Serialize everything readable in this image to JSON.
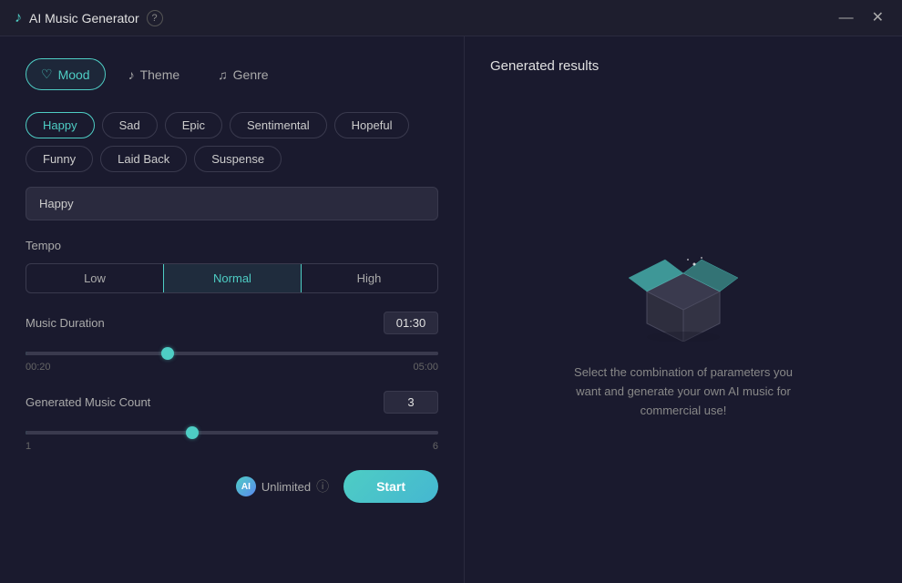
{
  "titleBar": {
    "title": "AI Music Generator",
    "helpLabel": "?",
    "minimizeLabel": "—",
    "closeLabel": "✕"
  },
  "tabs": [
    {
      "id": "mood",
      "label": "Mood",
      "icon": "♡",
      "active": true
    },
    {
      "id": "theme",
      "label": "Theme",
      "icon": "♪",
      "active": false
    },
    {
      "id": "genre",
      "label": "Genre",
      "icon": "♫",
      "active": false
    }
  ],
  "moodOptions": [
    {
      "label": "Happy",
      "selected": true
    },
    {
      "label": "Sad",
      "selected": false
    },
    {
      "label": "Epic",
      "selected": false
    },
    {
      "label": "Sentimental",
      "selected": false
    },
    {
      "label": "Hopeful",
      "selected": false
    },
    {
      "label": "Funny",
      "selected": false
    },
    {
      "label": "Laid Back",
      "selected": false
    },
    {
      "label": "Suspense",
      "selected": false
    }
  ],
  "selectedMood": "Happy",
  "tempo": {
    "label": "Tempo",
    "options": [
      {
        "label": "Low",
        "selected": false
      },
      {
        "label": "Normal",
        "selected": true
      },
      {
        "label": "High",
        "selected": false
      }
    ]
  },
  "musicDuration": {
    "label": "Music Duration",
    "min": "00:20",
    "max": "05:00",
    "value": "01:30",
    "fillPercent": 34
  },
  "generatedCount": {
    "label": "Generated Music Count",
    "min": "1",
    "max": "6",
    "value": "3",
    "fillPercent": 40
  },
  "unlimited": {
    "label": "Unlimited",
    "iconLabel": "AI"
  },
  "startButton": "Start",
  "results": {
    "title": "Generated results",
    "description": "Select the combination of parameters you want and generate your own AI music for commercial use!"
  }
}
